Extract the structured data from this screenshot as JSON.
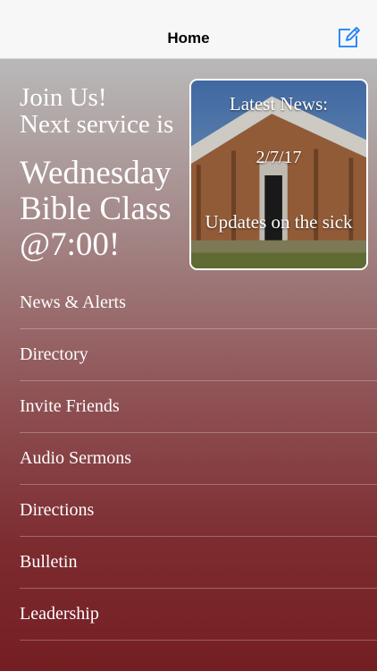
{
  "navbar": {
    "title": "Home",
    "compose_icon": "compose-icon"
  },
  "hero": {
    "line1": "Join Us!",
    "line2": "Next service is",
    "event_line1": "Wednesday",
    "event_line2": "Bible Class",
    "event_line3": "@7:00!"
  },
  "news_card": {
    "heading": "Latest News:",
    "date": "2/7/17",
    "headline": "Updates on the sick",
    "image": "church-building-photo"
  },
  "menu": {
    "items": [
      {
        "label": "News & Alerts"
      },
      {
        "label": "Directory"
      },
      {
        "label": "Invite Friends"
      },
      {
        "label": "Audio Sermons"
      },
      {
        "label": "Directions"
      },
      {
        "label": "Bulletin"
      },
      {
        "label": "Leadership"
      }
    ]
  },
  "colors": {
    "navbar_bg": "#f7f7f7",
    "accent": "#1a7dfa",
    "gradient_top": "#b9b9b9",
    "gradient_bottom": "#741e22",
    "text": "#ffffff"
  }
}
